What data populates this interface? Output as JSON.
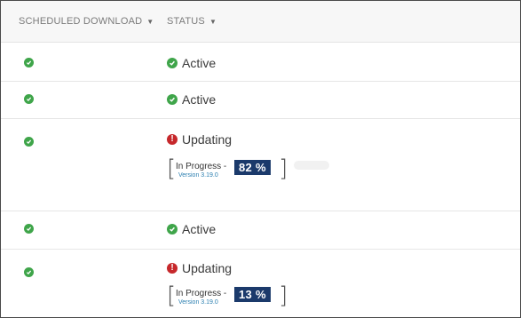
{
  "columns": {
    "scheduled_download": "SCHEDULED DOWNLOAD",
    "status": "STATUS",
    "sort_icon": "caret-down-icon"
  },
  "colors": {
    "active_green": "#3fa54a",
    "error_red": "#c6282b",
    "percent_bg": "#1b3a6b",
    "version_link": "#2b7fb0"
  },
  "rows": [
    {
      "status": "Active"
    },
    {
      "status": "Active"
    },
    {
      "status": "Updating",
      "progress_label": "In Progress -",
      "percent": "82 %",
      "version": "Version 3.19.0"
    },
    {
      "status": "Active"
    },
    {
      "status": "Updating",
      "progress_label": "In Progress -",
      "percent": "13 %",
      "version": "Version 3.19.0"
    }
  ]
}
